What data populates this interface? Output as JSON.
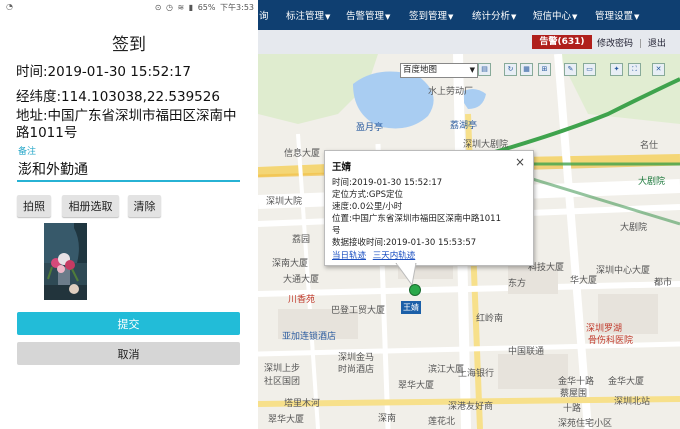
{
  "phone": {
    "statusbar": {
      "left_text": "ð",
      "right_text": "◯ ⊕ ✉ ⁵⁶ ⁴⁶ 65%",
      "battery": "65%",
      "time": "下午3:53"
    },
    "title": "签到",
    "time_line": "时间:2019-01-30 15:52:17",
    "coord_line": "经纬度:114.103038,22.539526",
    "address_line": "地址:中国广东省深圳市福田区深南中路1011号",
    "remark_label": "备注",
    "remark_value": "澎和外勤通",
    "buttons": {
      "photo": "拍照",
      "album": "相册选取",
      "clear": "清除",
      "submit": "提交",
      "cancel": "取消"
    }
  },
  "web": {
    "nav": {
      "partial_left": "询",
      "items": [
        "标注管理",
        "告警管理",
        "签到管理",
        "统计分析",
        "短信中心",
        "管理设置"
      ]
    },
    "alarm_badge": "告警(631)",
    "change_password": "修改密码",
    "logout": "退出",
    "map_type": "百度地图",
    "map_labels": [
      "水上劳动厂",
      "盈月亭",
      "荔湖亭",
      "信息大厦",
      "深圳大剧院",
      "名仕",
      "大剧院",
      "大剧院",
      "深圳大院",
      "荔园",
      "东方",
      "深南大厦",
      "大通大厦",
      "科技大厦",
      "深圳中心大厦",
      "华大厦",
      "都市",
      "川香苑",
      "巴登工贸大厦",
      "红岭南",
      "亚加连锁酒店",
      "深圳罗湖",
      "骨伤科医院",
      "深圳金马",
      "时尚酒店",
      "滨江大厦",
      "上海银行",
      "中国联通",
      "深港友好商",
      "深圳上步",
      "社区国团",
      "塔里木河",
      "翠华大厦",
      "金华十路",
      "蔡屋围",
      "十路",
      "金华大厦",
      "翠华大厦",
      "深圳北站",
      "莲花北",
      "深南",
      "深苑住宅小区"
    ],
    "popup": {
      "name": "王婧",
      "time": "时间:2019-01-30 15:52:17",
      "method": "定位方式:GPS定位",
      "speed": "速度:0.0公里/小时",
      "position_1": "位置:中国广东省深圳市福田区深南中路1011",
      "position_2": "号",
      "received": "数据接收时间:2019-01-30 15:53:57",
      "link_today": "当日轨迹",
      "link_three_days": "三天内轨迹",
      "close": "×"
    },
    "marker_label": "王婧"
  }
}
